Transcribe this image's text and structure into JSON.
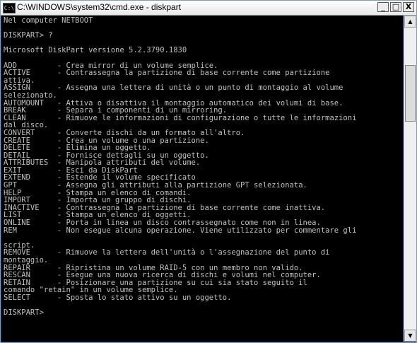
{
  "window": {
    "title": "C:\\WINDOWS\\system32\\cmd.exe - diskpart",
    "icon_text": "C:\\",
    "buttons": {
      "minimize": "_",
      "maximize": "□",
      "close": "X"
    }
  },
  "console": {
    "lines": [
      "Nel computer NETBOOT",
      "",
      "DISKPART> ?",
      "",
      "Microsoft DiskPart versione 5.2.3790.1830",
      "",
      "ADD         - Crea mirror di un volume semplice.",
      "ACTIVE      - Contrassegna la partizione di base corrente come partizione",
      "attiva.",
      "ASSIGN      - Assegna una lettera di unità o un punto di montaggio al volume",
      "selezionato.",
      "AUTOMOUNT   - Attiva o disattiva il montaggio automatico dei volumi di base.",
      "BREAK       - Separa i componenti di un mirroring.",
      "CLEAN       - Rimuove le informazioni di configurazione o tutte le informazioni",
      "dal disco.",
      "CONVERT     - Converte dischi da un formato all'altro.",
      "CREATE      - Crea un volume o una partizione.",
      "DELETE      - Elimina un oggetto.",
      "DETAIL      - Fornisce dettagli su un oggetto.",
      "ATTRIBUTES  - Manipola attributi del volume.",
      "EXIT        - Esci da DiskPart",
      "EXTEND      - Estende il volume specificato",
      "GPT         - Assegna gli attributi alla partizione GPT selezionata.",
      "HELP        - Stampa un elenco di comandi.",
      "IMPORT      - Importa un gruppo di dischi.",
      "INACTIVE    - Contrassegna la partizione di base corrente come inattiva.",
      "LIST        - Stampa un elenco di oggetti.",
      "ONLINE      - Porta in linea un disco contrassegnato come non in linea.",
      "REM         - Non esegue alcuna operazione. Viene utilizzato per commentare gli",
      "",
      "script.",
      "REMOVE      - Rimuove la lettera dell'unità o l'assegnazione del punto di",
      "montaggio.",
      "REPAIR      - Ripristina un volume RAID-5 con un membro non valido.",
      "RESCAN      - Esegue una nuova ricerca di dischi e volumi nel computer.",
      "RETAIN      - Posizionare una partizione su cui sia stato seguito il",
      "comando \"retain\" in un volume semplice.",
      "SELECT      - Sposta lo stato attivo su un oggetto.",
      "",
      "DISKPART>"
    ]
  },
  "scrollbar": {
    "up_glyph": "▲",
    "down_glyph": "▼"
  }
}
